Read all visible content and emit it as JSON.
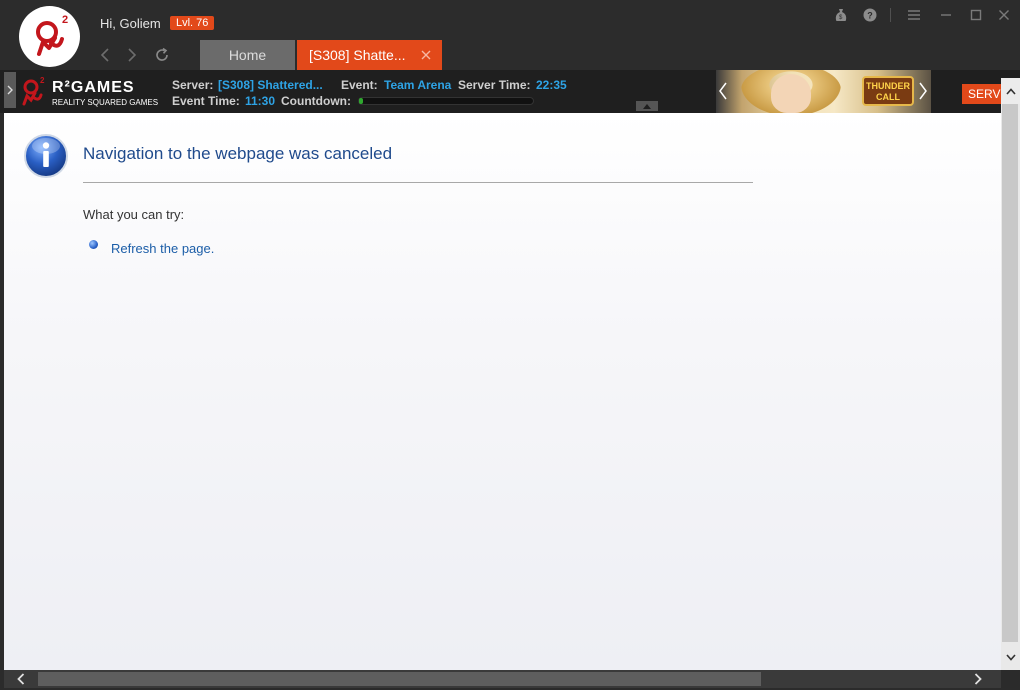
{
  "header": {
    "greeting": "Hi, Goliem",
    "level": "Lvl. 76",
    "tabs": [
      {
        "label": "Home",
        "active": false
      },
      {
        "label": "[S308] Shatte...",
        "active": true
      }
    ]
  },
  "infobar": {
    "brand_name": "R²GAMES",
    "brand_subtitle": "REALITY SQUARED GAMES",
    "server_label": "Server:",
    "server_value": "[S308] Shattered...",
    "event_label": "Event:",
    "event_value": "Team Arena",
    "server_time_label": "Server Time:",
    "server_time_value": "22:35",
    "event_time_label": "Event Time:",
    "event_time_value": "11:30",
    "countdown_label": "Countdown:",
    "countdown_progress": 0.02,
    "banner_game_text": "THUNDER CALL",
    "server_button": "SERV"
  },
  "page": {
    "title": "Navigation to the webpage was canceled",
    "try_label": "What you can try:",
    "suggestion_link": "Refresh the page."
  },
  "colors": {
    "accent": "#e2491a",
    "info_blue": "#2ea3e5",
    "title_blue": "#1f4a8c",
    "link_blue": "#1c5ea8"
  },
  "icons": {
    "back": "chevron-left-icon",
    "forward": "chevron-right-icon",
    "reload": "reload-icon",
    "wallet": "money-bag-icon",
    "help": "help-icon",
    "menu": "menu-icon",
    "minimize": "minimize-icon",
    "maximize": "maximize-icon",
    "close": "close-icon",
    "info": "info-icon"
  }
}
